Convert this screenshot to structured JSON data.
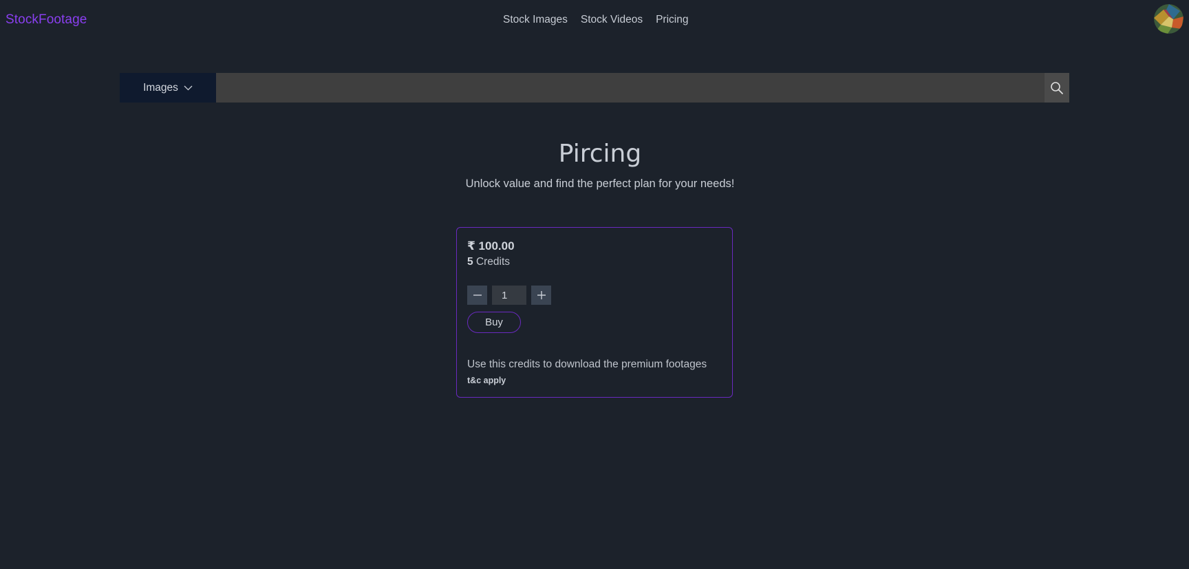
{
  "header": {
    "logo": "StockFootage",
    "nav": [
      "Stock Images",
      "Stock Videos",
      "Pricing"
    ]
  },
  "search": {
    "type_label": "Images",
    "placeholder": ""
  },
  "page": {
    "title": "Pircing",
    "subtitle": "Unlock value and find the perfect plan for your needs!"
  },
  "plan": {
    "price": "₹ 100.00",
    "credits_count": "5",
    "credits_label": "Credits",
    "quantity": "1",
    "buy_label": "Buy",
    "description": "Use this credits to download the premium footages",
    "terms": "t&c apply"
  },
  "colors": {
    "background": "#1c222b",
    "accent": "#8a3ff0",
    "card_border": "#6a2ac0"
  }
}
